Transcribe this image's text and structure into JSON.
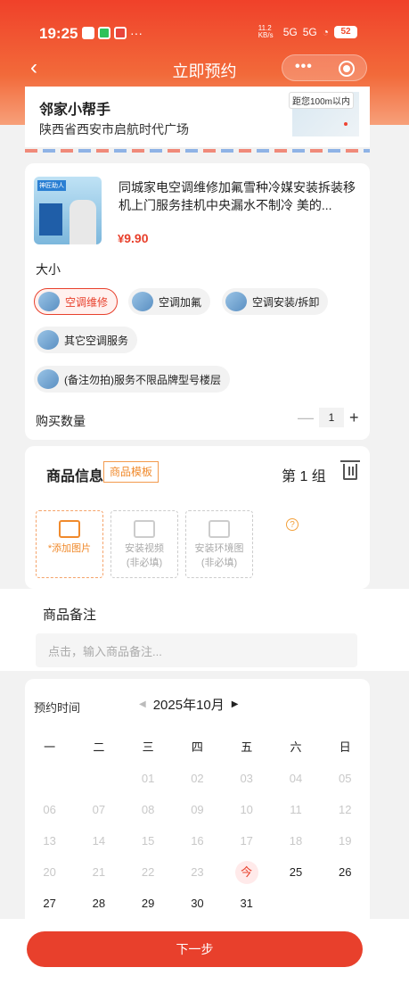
{
  "status": {
    "time": "19:25",
    "net_speed": "11.2 KB/s",
    "signal1": "5G",
    "signal2": "5G",
    "battery": "52"
  },
  "nav": {
    "back": "‹",
    "title": "立即预约",
    "more": "•••"
  },
  "address": {
    "name": "邻家小帮手",
    "detail": "陕西省西安市启航时代广场",
    "distance": "距您100m以内"
  },
  "product": {
    "image_tag": "神匠助人",
    "title": "同城家电空调维修加氟雪种冷媒安装拆装移机上门服务挂机中央漏水不制冷 美的...",
    "price_symbol": "¥",
    "price": "9.90",
    "size_label": "大小",
    "options": [
      {
        "label": "空调维修",
        "selected": true
      },
      {
        "label": "空调加氟",
        "selected": false
      },
      {
        "label": "空调安装/拆卸",
        "selected": false
      },
      {
        "label": "其它空调服务",
        "selected": false
      },
      {
        "label": "(备注勿拍)服务不限品牌型号楼层",
        "selected": false
      }
    ],
    "qty_label": "购买数量",
    "qty_minus": "—",
    "qty": "1",
    "qty_plus": "+"
  },
  "goods_info": {
    "title": "商品信息",
    "template": "商品模板",
    "group": "第 1 组",
    "uploads": [
      {
        "label": "*添加图片",
        "sub": ""
      },
      {
        "label": "安装视频",
        "sub": "(非必填)"
      },
      {
        "label": "安装环境图",
        "sub": "(非必填)"
      }
    ],
    "help": "?"
  },
  "note": {
    "title": "商品备注",
    "placeholder": "点击，输入商品备注..."
  },
  "calendar": {
    "label": "预约时间",
    "prev": "◀",
    "month": "2025年10月",
    "next": "▶",
    "weekdays": [
      "一",
      "二",
      "三",
      "四",
      "五",
      "六",
      "日"
    ],
    "weeks": [
      [
        "",
        "",
        "01",
        "02",
        "03",
        "04",
        "05"
      ],
      [
        "06",
        "07",
        "08",
        "09",
        "10",
        "11",
        "12"
      ],
      [
        "13",
        "14",
        "15",
        "16",
        "17",
        "18",
        "19"
      ],
      [
        "20",
        "21",
        "22",
        "23",
        "今",
        "25",
        "26"
      ],
      [
        "27",
        "28",
        "29",
        "30",
        "31",
        "",
        ""
      ]
    ],
    "today": "今"
  },
  "footer": {
    "next_label": "下一步"
  },
  "colors": {
    "accent": "#e8402c",
    "template": "#f08a2c"
  }
}
